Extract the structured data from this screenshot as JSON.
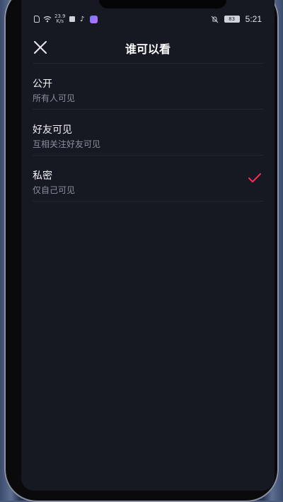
{
  "status_bar": {
    "speed_value": "23.9",
    "speed_unit": "K/s",
    "battery": "83",
    "time": "5:21",
    "icons": [
      "sim-icon",
      "wifi-icon",
      "notification-square-icon",
      "tiktok-icon",
      "app-icon",
      "bell-muted-icon",
      "battery-icon"
    ]
  },
  "header": {
    "title": "谁可以看",
    "close_icon": "close-icon"
  },
  "options": [
    {
      "label": "公开",
      "desc": "所有人可见",
      "selected": false
    },
    {
      "label": "好友可见",
      "desc": "互相关注好友可见",
      "selected": false
    },
    {
      "label": "私密",
      "desc": "仅自己可见",
      "selected": true
    }
  ],
  "colors": {
    "background": "#171922",
    "check_accent": "#fe2c55"
  }
}
